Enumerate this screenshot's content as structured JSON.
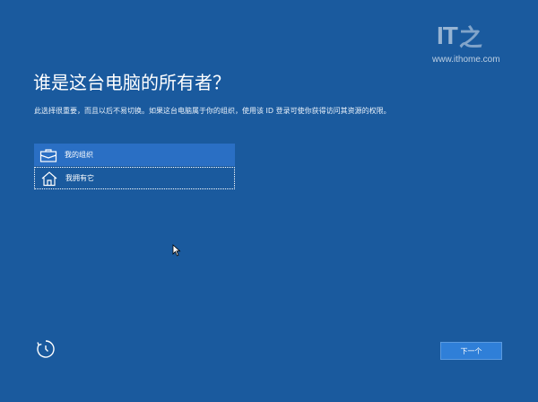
{
  "watermark": {
    "logo": "IT之家",
    "url": "www.ithome.com"
  },
  "title": "谁是这台电脑的所有者？",
  "description": "此选择很重要，而且以后不易切换。如果这台电脑属于你的组织，使用该 ID 登录可使你获得访问其资源的权限。",
  "options": [
    {
      "label": "我的组织",
      "icon": "briefcase-icon",
      "selected": true
    },
    {
      "label": "我拥有它",
      "icon": "home-icon",
      "selected": false
    }
  ],
  "footer": {
    "ease_of_access_icon": "ease-of-access-icon",
    "next_label": "下一个"
  },
  "colors": {
    "background": "#1a5a9e",
    "selected_option": "#2a6fc4",
    "button": "#2f7fd8"
  }
}
